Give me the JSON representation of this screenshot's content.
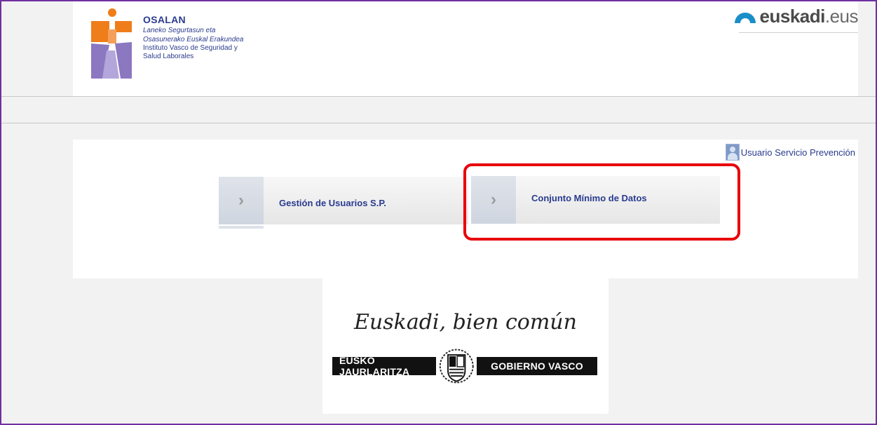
{
  "header": {
    "osalan": {
      "name": "OSALAN",
      "basque_line1": "Laneko Segurtasun eta",
      "basque_line2": "Osasunerako Euskal Erakundea",
      "spanish_line1": "Instituto Vasco de Seguridad y",
      "spanish_line2": "Salud Laborales"
    },
    "euskadi": {
      "name": "euskadi",
      "tld": ".eus"
    }
  },
  "user": {
    "label": "Usuario Servicio Prevención",
    "icon": "user-avatar-icon"
  },
  "menu": {
    "tiles": [
      {
        "label": "Gestión de Usuarios S.P.",
        "icon": "chevron-right-icon"
      },
      {
        "label": "Conjunto Mínimo de Datos",
        "icon": "chevron-right-icon",
        "highlighted": true
      }
    ]
  },
  "footer": {
    "slogan": "Euskadi, bien común",
    "gov_basque": "EUSKO JAURLARITZA",
    "gov_spanish": "GOBIERNO VASCO"
  },
  "colors": {
    "link_blue": "#2a3b8f",
    "highlight_red": "#e8000b",
    "frame_purple": "#7030a0",
    "osalan_orange": "#ef7d1a",
    "osalan_purple": "#8b78c0"
  }
}
